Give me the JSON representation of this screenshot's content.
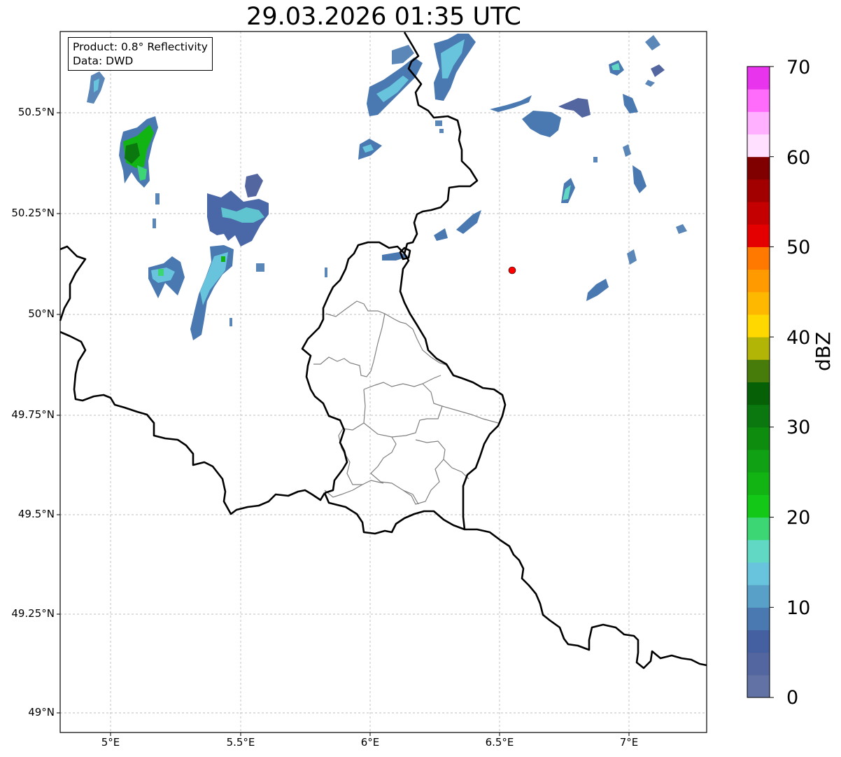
{
  "title": "29.03.2026 01:35 UTC",
  "info": {
    "product": "Product: 0.8° Reflectivity",
    "data": "Data: DWD"
  },
  "axes": {
    "lat_ticks": [
      "50.5°N",
      "50.25°N",
      "50°N",
      "49.75°N",
      "49.5°N",
      "49.25°N",
      "49°N"
    ],
    "lon_ticks": [
      "5°E",
      "5.5°E",
      "6°E",
      "6.5°E",
      "7°E"
    ],
    "lon_range": [
      4.8,
      7.3
    ],
    "lat_range": [
      48.95,
      50.7
    ],
    "grid": true
  },
  "colorbar": {
    "label": "dBZ",
    "ticks": [
      "70",
      "60",
      "50",
      "40",
      "30",
      "20",
      "10",
      "0"
    ],
    "colors": [
      "#6272a4",
      "#5366a0",
      "#4460a0",
      "#4a78b0",
      "#58a0c8",
      "#68c4dc",
      "#60d8c4",
      "#3cd674",
      "#14c818",
      "#12b414",
      "#10a214",
      "#0e8c0e",
      "#0a780e",
      "#066006",
      "#487c0a",
      "#b2b406",
      "#ffd800",
      "#ffb800",
      "#ff9a00",
      "#ff7800",
      "#e40000",
      "#c40000",
      "#a20000",
      "#800000",
      "#ffe0ff",
      "#ffb0ff",
      "#ff6cfc",
      "#e834ec"
    ]
  },
  "marker": {
    "name": "radar-site",
    "color": "#ff0000",
    "lon": 6.55,
    "lat": 50.11
  }
}
